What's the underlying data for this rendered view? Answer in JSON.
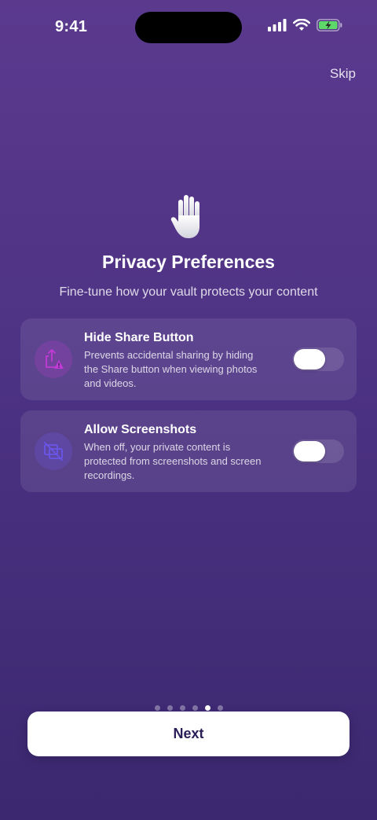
{
  "status_bar": {
    "time": "9:41"
  },
  "header": {
    "skip_label": "Skip"
  },
  "hero": {
    "icon": "raised-hand-icon",
    "title": "Privacy Preferences",
    "subtitle": "Fine-tune how your vault protects your content"
  },
  "settings": [
    {
      "icon": "share-warning-icon",
      "title": "Hide Share Button",
      "description": "Prevents accidental sharing by hiding the Share button when viewing photos and videos.",
      "enabled": false
    },
    {
      "icon": "screenshot-blocked-icon",
      "title": "Allow Screenshots",
      "description": "When off, your private content is protected from screenshots and screen recordings.",
      "enabled": false
    }
  ],
  "pagination": {
    "total": 6,
    "current": 5
  },
  "footer": {
    "next_label": "Next"
  },
  "colors": {
    "background": "#4d3283",
    "share_icon_accent": "#c23bd4",
    "screenshot_icon_accent": "#6a56e8",
    "button_text": "#2b1d57"
  }
}
